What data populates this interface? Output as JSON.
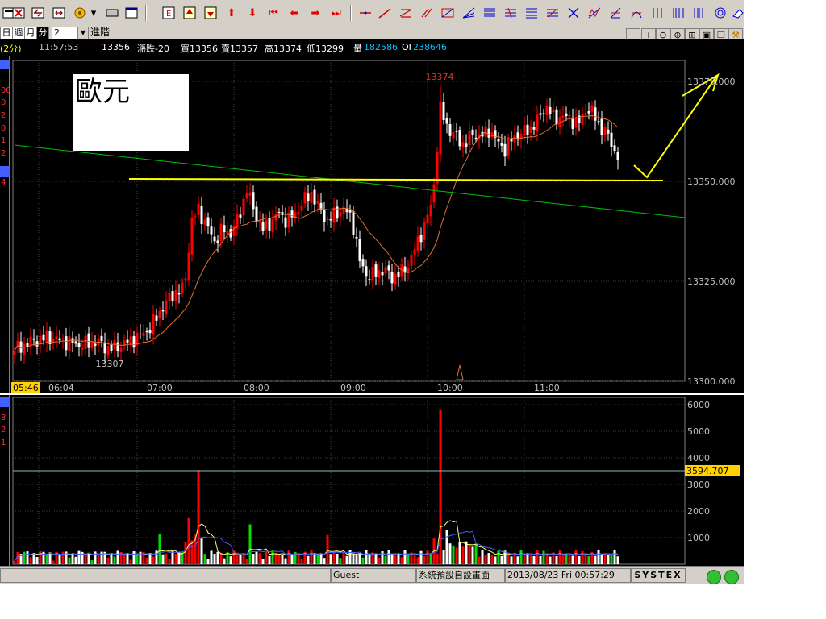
{
  "window": {
    "background": "#000000",
    "chrome": "#d4d0c8"
  },
  "period_buttons": [
    {
      "label": "日",
      "active": false
    },
    {
      "label": "週",
      "active": false
    },
    {
      "label": "月",
      "active": false
    },
    {
      "label": "分",
      "active": true
    }
  ],
  "interval_value": "2",
  "advanced_label": "進階",
  "quote": {
    "period": "(2分)",
    "time": "11:57:53",
    "last": "13356",
    "change": "漲跌-20",
    "bid": "買13356",
    "ask": "賣13357",
    "high": "高13374",
    "low": "低13299",
    "volume_label": "量",
    "volume": "182586",
    "oi_label": "OI",
    "oi": "238646"
  },
  "price_panel": {
    "label_text": "歐元",
    "y_ticks": [
      "13375.000",
      "13350.000",
      "13325.000",
      "13300.000"
    ],
    "x_ticks": [
      "06:04",
      "07:00",
      "08:00",
      "09:00",
      "10:00",
      "11:00"
    ],
    "current_time_tag": "05:46",
    "high_annotation": "13374",
    "low_annotation": "13307",
    "left_partial_labels": [
      "00",
      "0",
      "2",
      "0",
      "1",
      "2",
      "4"
    ]
  },
  "volume_panel": {
    "y_ticks": [
      "6000",
      "5000",
      "4000",
      "3000",
      "2000",
      "1000"
    ],
    "current_value_tag": "3594.707",
    "left_partial_labels": [
      "8",
      "2",
      "1"
    ]
  },
  "colors": {
    "up": "#ff0000",
    "down": "#ffffff",
    "ma": "#e07030",
    "trendline": "#00c000",
    "support": "#ffff00",
    "arrow": "#ffff00",
    "vol_green": "#00e000",
    "ma_vol_yellow": "#ffff80",
    "ma_vol_blue": "#4060ff",
    "tag": "#ffd200"
  },
  "icons": [
    "open-icon",
    "close-icon",
    "tile-icon",
    "restore-icon",
    "gear-icon",
    "dropdown-icon",
    "layout-icon",
    "window-icon"
  ],
  "status": {
    "user": "Guest",
    "layout": "系統預設自設畫面",
    "datetime": "2013/08/23 Fri 00:57:29",
    "brand": "SYSTEX"
  }
}
